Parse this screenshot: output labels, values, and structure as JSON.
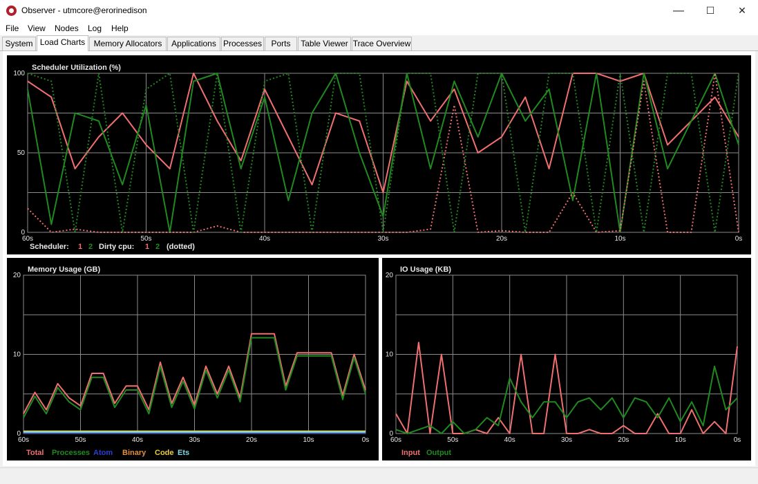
{
  "window": {
    "title": "Observer - utmcore@erorinedison",
    "minimize": "—",
    "maximize": "☐",
    "close": "✕"
  },
  "menu": [
    "File",
    "View",
    "Nodes",
    "Log",
    "Help"
  ],
  "tabs": [
    "System",
    "Load Charts",
    "Memory Allocators",
    "Applications",
    "Processes",
    "Ports",
    "Table Viewer",
    "Trace Overview"
  ],
  "active_tab": 1,
  "colors": {
    "red": "#f07070",
    "green": "#208a20",
    "blue": "#2a3fd0",
    "orange": "#e09040",
    "yellow": "#e8d040",
    "cyan": "#80d8e8",
    "grid": "#8c8c8c",
    "text": "#e8e8e8"
  },
  "scheduler_chart": {
    "title": "Scheduler Utilization (%)",
    "legend_prefix": "Scheduler:",
    "legend_s1": "1",
    "legend_s2": "2",
    "legend_dirty": "Dirty cpu:",
    "legend_d1": "1",
    "legend_d2": "2",
    "legend_suffix": "(dotted)"
  },
  "memory_chart": {
    "title": "Memory Usage (GB)",
    "legend": [
      {
        "label": "Total",
        "color": "#f07070"
      },
      {
        "label": "Processes",
        "color": "#208a20"
      },
      {
        "label": "Atom",
        "color": "#2a3fd0"
      },
      {
        "label": "Binary",
        "color": "#e09040"
      },
      {
        "label": "Code",
        "color": "#e8d040"
      },
      {
        "label": "Ets",
        "color": "#80d8e8"
      }
    ]
  },
  "io_chart": {
    "title": "IO Usage (KB)",
    "legend": [
      {
        "label": "Input",
        "color": "#f07070"
      },
      {
        "label": "Output",
        "color": "#208a20"
      }
    ]
  },
  "chart_data": [
    {
      "type": "line",
      "title": "Scheduler Utilization (%)",
      "x_ticks": [
        "60s",
        "50s",
        "40s",
        "30s",
        "20s",
        "10s",
        "0s"
      ],
      "x": [
        60,
        58,
        56,
        54,
        52,
        50,
        48,
        46,
        44,
        42,
        40,
        38,
        36,
        34,
        32,
        30,
        28,
        26,
        24,
        22,
        20,
        18,
        16,
        14,
        12,
        10,
        8,
        6,
        4,
        2,
        0
      ],
      "y_ticks": [
        "0",
        "50",
        "100"
      ],
      "ylim": [
        0,
        100
      ],
      "series": [
        {
          "name": "1",
          "group": "Scheduler",
          "values": [
            95,
            85,
            40,
            60,
            75,
            55,
            40,
            100,
            70,
            45,
            90,
            60,
            30,
            75,
            70,
            25,
            95,
            70,
            90,
            50,
            60,
            85,
            40,
            100,
            100,
            95,
            100,
            55,
            70,
            85,
            60
          ]
        },
        {
          "name": "2",
          "group": "Scheduler",
          "values": [
            90,
            5,
            75,
            70,
            30,
            80,
            0,
            95,
            100,
            40,
            85,
            20,
            75,
            100,
            50,
            10,
            100,
            40,
            95,
            60,
            100,
            70,
            90,
            20,
            100,
            0,
            100,
            40,
            70,
            100,
            55
          ]
        },
        {
          "name": "1",
          "group": "Dirty cpu",
          "style": "dotted",
          "values": [
            15,
            0,
            2,
            0,
            0,
            0,
            0,
            0,
            4,
            0,
            0,
            0,
            0,
            0,
            0,
            0,
            0,
            2,
            80,
            0,
            1,
            0,
            0,
            25,
            0,
            1,
            95,
            0,
            0,
            100,
            0
          ]
        },
        {
          "name": "2",
          "group": "Dirty cpu",
          "style": "dotted",
          "values": [
            100,
            95,
            0,
            100,
            0,
            90,
            100,
            0,
            100,
            0,
            95,
            100,
            0,
            100,
            100,
            0,
            100,
            100,
            0,
            100,
            100,
            0,
            100,
            100,
            0,
            100,
            0,
            100,
            100,
            0,
            100
          ]
        }
      ]
    },
    {
      "type": "line",
      "title": "Memory Usage (GB)",
      "x_ticks": [
        "60s",
        "50s",
        "40s",
        "30s",
        "20s",
        "10s",
        "0s"
      ],
      "x": [
        60,
        58,
        56,
        54,
        52,
        50,
        48,
        46,
        44,
        42,
        40,
        38,
        36,
        34,
        32,
        30,
        28,
        26,
        24,
        22,
        20,
        18,
        16,
        14,
        12,
        10,
        8,
        6,
        4,
        2,
        0
      ],
      "y_ticks": [
        "0",
        "10",
        "20"
      ],
      "ylim": [
        0,
        20
      ],
      "series": [
        {
          "name": "Total",
          "values": [
            2.5,
            5.2,
            3.0,
            6.3,
            4.5,
            3.5,
            7.6,
            7.6,
            3.8,
            6.0,
            6.0,
            3.0,
            9.0,
            3.8,
            7.1,
            3.6,
            8.5,
            5.0,
            8.5,
            4.5,
            12.6,
            12.6,
            12.6,
            6.0,
            10.2,
            10.2,
            10.2,
            10.2,
            4.8,
            10.0,
            5.5
          ]
        },
        {
          "name": "Processes",
          "values": [
            2.0,
            4.7,
            2.5,
            5.8,
            4.0,
            3.0,
            7.1,
            7.1,
            3.3,
            5.5,
            5.5,
            2.5,
            8.5,
            3.3,
            6.6,
            3.1,
            8.0,
            4.5,
            8.0,
            4.0,
            12.1,
            12.1,
            12.1,
            5.5,
            9.8,
            9.8,
            9.8,
            9.8,
            4.3,
            9.6,
            5.0
          ]
        },
        {
          "name": "Atom",
          "values": [
            0.1,
            0.1,
            0.1,
            0.1,
            0.1,
            0.1,
            0.1,
            0.1,
            0.1,
            0.1,
            0.1,
            0.1,
            0.1,
            0.1,
            0.1,
            0.1,
            0.1,
            0.1,
            0.1,
            0.1,
            0.1,
            0.1,
            0.1,
            0.1,
            0.1,
            0.1,
            0.1,
            0.1,
            0.1,
            0.1,
            0.1
          ]
        },
        {
          "name": "Binary",
          "values": [
            0.2,
            0.2,
            0.2,
            0.2,
            0.2,
            0.2,
            0.2,
            0.2,
            0.2,
            0.2,
            0.2,
            0.2,
            0.2,
            0.2,
            0.2,
            0.2,
            0.2,
            0.2,
            0.2,
            0.2,
            0.2,
            0.2,
            0.2,
            0.2,
            0.2,
            0.2,
            0.2,
            0.2,
            0.2,
            0.2,
            0.2
          ]
        },
        {
          "name": "Code",
          "values": [
            0.3,
            0.3,
            0.3,
            0.3,
            0.3,
            0.3,
            0.3,
            0.3,
            0.3,
            0.3,
            0.3,
            0.3,
            0.3,
            0.3,
            0.3,
            0.3,
            0.3,
            0.3,
            0.3,
            0.3,
            0.3,
            0.3,
            0.3,
            0.3,
            0.3,
            0.3,
            0.3,
            0.3,
            0.3,
            0.3,
            0.3
          ]
        },
        {
          "name": "Ets",
          "values": [
            0.2,
            0.2,
            0.2,
            0.2,
            0.2,
            0.2,
            0.2,
            0.2,
            0.2,
            0.2,
            0.2,
            0.2,
            0.2,
            0.2,
            0.2,
            0.2,
            0.2,
            0.2,
            0.2,
            0.2,
            0.2,
            0.2,
            0.2,
            0.2,
            0.2,
            0.2,
            0.2,
            0.2,
            0.2,
            0.2,
            0.2
          ]
        }
      ]
    },
    {
      "type": "line",
      "title": "IO Usage (KB)",
      "x_ticks": [
        "60s",
        "50s",
        "40s",
        "30s",
        "20s",
        "10s",
        "0s"
      ],
      "x": [
        60,
        58,
        56,
        54,
        52,
        50,
        48,
        46,
        44,
        42,
        40,
        38,
        36,
        34,
        32,
        30,
        28,
        26,
        24,
        22,
        20,
        18,
        16,
        14,
        12,
        10,
        8,
        6,
        4,
        2,
        0
      ],
      "y_ticks": [
        "0",
        "10",
        "20"
      ],
      "ylim": [
        0,
        20
      ],
      "series": [
        {
          "name": "Input",
          "values": [
            2.5,
            0,
            11.5,
            0,
            10.0,
            0,
            0,
            0.5,
            0,
            2.0,
            0,
            10.0,
            0,
            0,
            10.0,
            0,
            0,
            0.5,
            0,
            0,
            1.0,
            0,
            0,
            2.5,
            0,
            0,
            3.0,
            0,
            1.5,
            0,
            11.0
          ]
        },
        {
          "name": "Output",
          "values": [
            0.5,
            0,
            0.5,
            1.0,
            0,
            1.5,
            0,
            0.5,
            2.0,
            1.0,
            7.0,
            4.0,
            2.0,
            4.0,
            4.0,
            2.0,
            4.0,
            4.5,
            3.0,
            4.5,
            2.0,
            4.5,
            4.0,
            2.0,
            4.5,
            1.5,
            4.0,
            1.0,
            8.5,
            3.0,
            4.5
          ]
        }
      ]
    }
  ]
}
